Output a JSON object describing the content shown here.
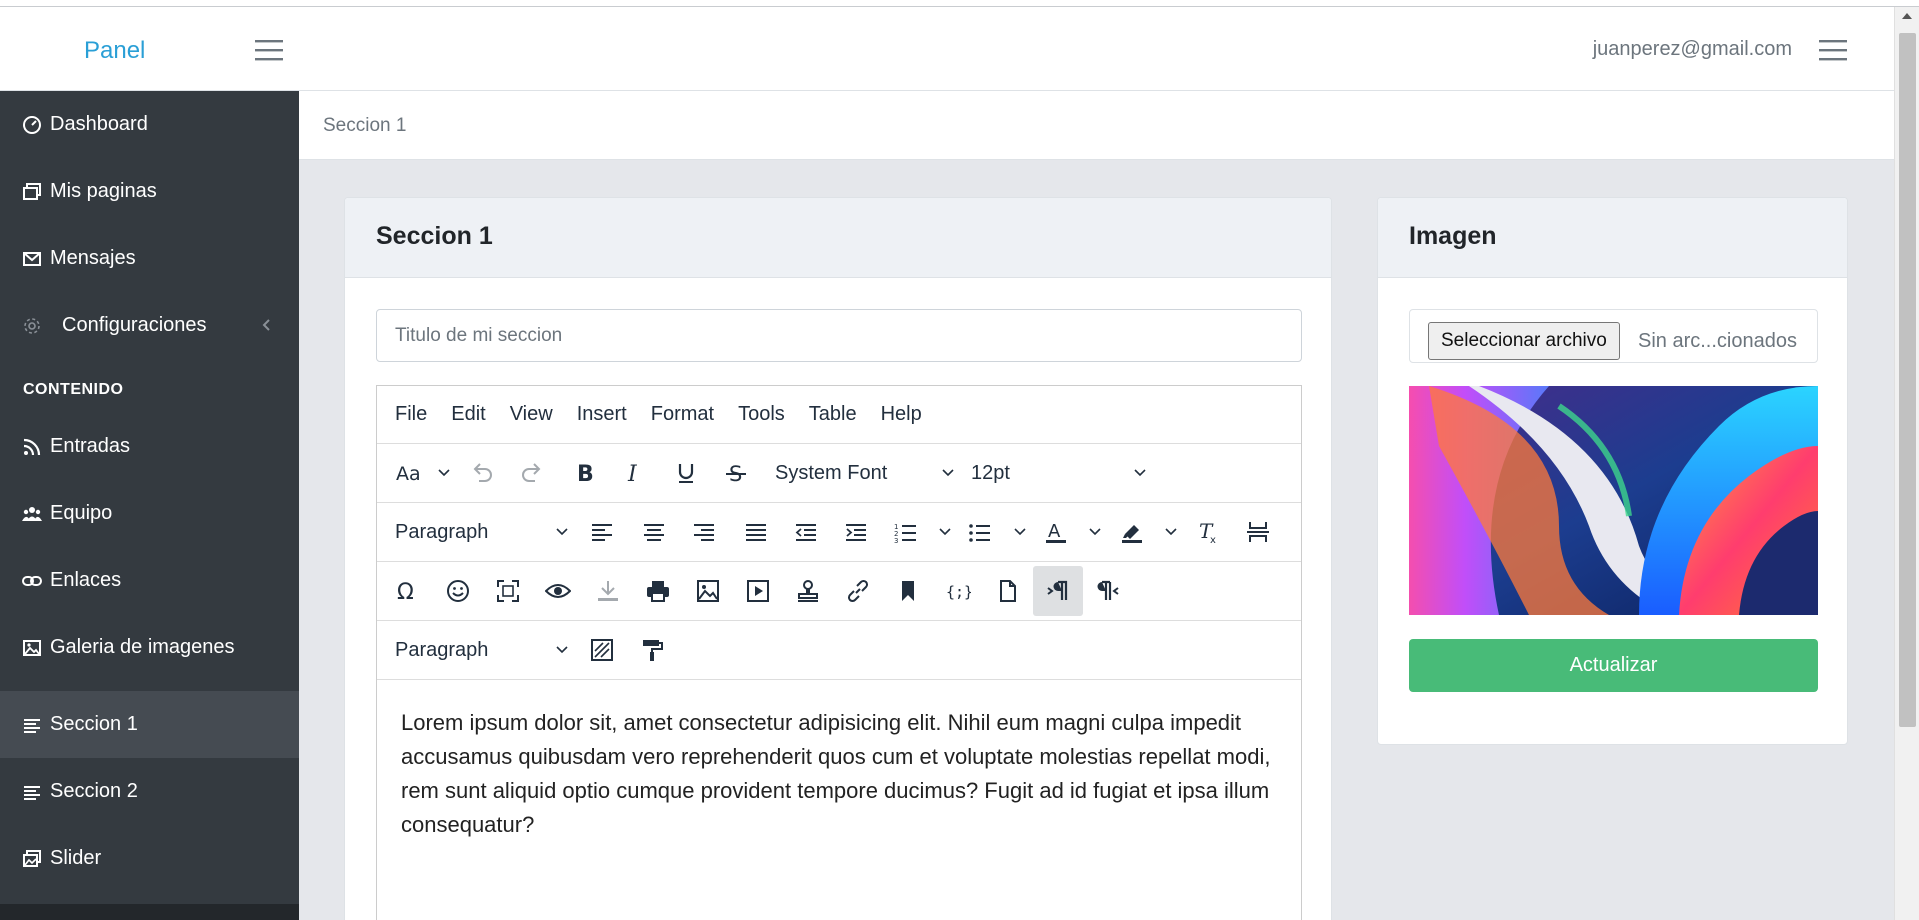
{
  "brand": {
    "title": "Panel"
  },
  "header": {
    "user_email": "juanperez@gmail.com"
  },
  "breadcrumb": "Seccion 1",
  "sidebar": {
    "section_label": "CONTENIDO",
    "items": [
      {
        "label": "Dashboard",
        "icon": "gauge-icon"
      },
      {
        "label": "Mis paginas",
        "icon": "window-icon"
      },
      {
        "label": "Mensajes",
        "icon": "envelope-icon"
      },
      {
        "label": "Configuraciones",
        "icon": "gear-icon"
      },
      {
        "label": "Entradas",
        "icon": "rss-icon"
      },
      {
        "label": "Equipo",
        "icon": "users-icon"
      },
      {
        "label": "Enlaces",
        "icon": "link-icon"
      },
      {
        "label": "Galeria de imagenes",
        "icon": "image-icon"
      },
      {
        "label": "Seccion 1",
        "icon": "lines-icon",
        "active": true
      },
      {
        "label": "Seccion 2",
        "icon": "lines-icon"
      },
      {
        "label": "Slider",
        "icon": "images-icon"
      }
    ]
  },
  "main_card": {
    "title": "Seccion 1",
    "title_input_placeholder": "Titulo de mi seccion",
    "editor": {
      "menu": [
        "File",
        "Edit",
        "View",
        "Insert",
        "Format",
        "Tools",
        "Table",
        "Help"
      ],
      "font_family": "System Font",
      "font_size": "12pt",
      "block_format": "Paragraph",
      "block_format_2": "Paragraph",
      "content": "Lorem ipsum dolor sit, amet consectetur adipisicing elit. Nihil eum magni culpa impedit accusamus quibusdam vero reprehenderit quos cum et voluptate molestias repellat modi, rem sunt aliquid optio cumque provident tempore ducimus? Fugit ad id fugiat et ipsa illum consequatur?"
    }
  },
  "side_card": {
    "title": "Imagen",
    "file_button": "Seleccionar archivo",
    "file_status": "Sin arc...cionados",
    "update_button": "Actualizar"
  },
  "colors": {
    "brand": "#2a9fd6",
    "sidebar_bg": "#343a40",
    "success": "#48bb78"
  }
}
